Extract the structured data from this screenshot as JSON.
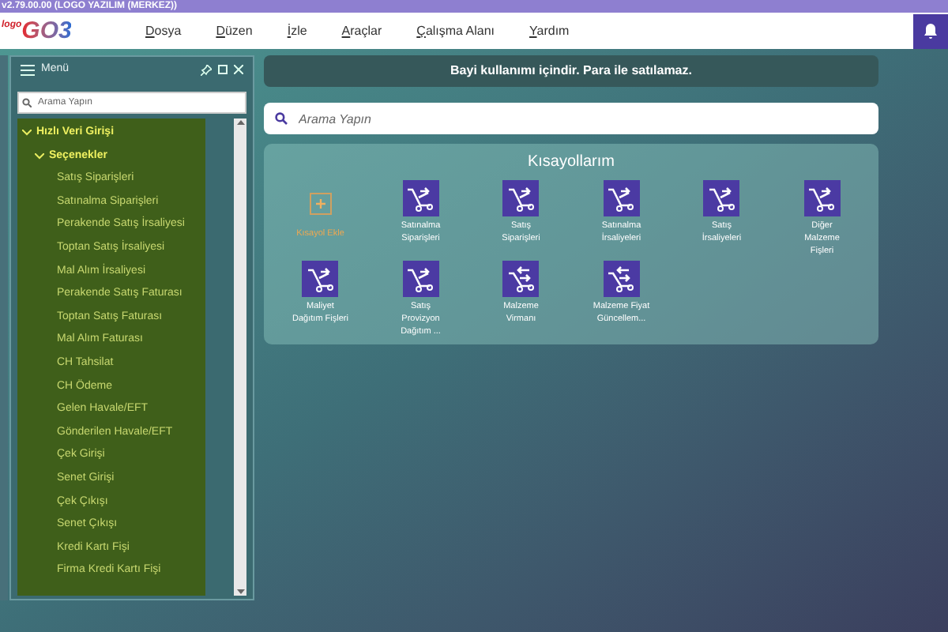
{
  "window": {
    "title": "v2.79.00.00 (LOGO YAZILIM (MERKEZ))"
  },
  "logo": {
    "prefix": "logo",
    "name": "GO3"
  },
  "menu_bar": [
    "Dosya",
    "Düzen",
    "İzle",
    "Araçlar",
    "Çalışma Alanı",
    "Yardım"
  ],
  "menu_panel": {
    "title": "Menü",
    "search": {
      "placeholder": "Arama Yapın"
    },
    "tree": [
      {
        "label": "Hızlı Veri Girişi",
        "expanded": true,
        "children": [
          {
            "label": "Seçenekler",
            "expanded": true,
            "children": [
              {
                "label": "Satış Siparişleri"
              },
              {
                "label": "Satınalma Siparişleri"
              },
              {
                "label": "Perakende Satış İrsaliyesi"
              },
              {
                "label": "Toptan Satış İrsaliyesi"
              },
              {
                "label": "Mal Alım İrsaliyesi"
              },
              {
                "label": "Perakende Satış Faturası"
              },
              {
                "label": "Toptan Satış Faturası"
              },
              {
                "label": "Mal Alım Faturası"
              },
              {
                "label": "CH Tahsilat"
              },
              {
                "label": "CH Ödeme"
              },
              {
                "label": "Gelen Havale/EFT"
              },
              {
                "label": "Gönderilen Havale/EFT"
              },
              {
                "label": "Çek Girişi"
              },
              {
                "label": "Senet Girişi"
              },
              {
                "label": "Çek Çıkışı"
              },
              {
                "label": "Senet Çıkışı"
              },
              {
                "label": "Kredi Kartı Fişi"
              },
              {
                "label": "Firma Kredi Kartı Fişi"
              }
            ]
          }
        ]
      }
    ]
  },
  "banner": "Bayi kullanımı içindir. Para ile satılamaz.",
  "search": {
    "placeholder": "Arama Yapın"
  },
  "shortcuts": {
    "title": "Kısayollarım",
    "items": [
      {
        "kind": "add",
        "label": "Kısayol Ekle"
      },
      {
        "kind": "cart",
        "label": "Satınalma Siparişleri"
      },
      {
        "kind": "cart",
        "label": "Satış Siparişleri"
      },
      {
        "kind": "cart",
        "label": "Satınalma İrsaliyeleri"
      },
      {
        "kind": "cart",
        "label": "Satış İrsaliyeleri"
      },
      {
        "kind": "cart",
        "label": "Diğer Malzeme Fişleri"
      },
      {
        "kind": "cart",
        "label": "Maliyet Dağıtım Fişleri"
      },
      {
        "kind": "cart",
        "label": "Satış Provizyon Dağıtım ..."
      },
      {
        "kind": "transfer",
        "label": "Malzeme Virmanı"
      },
      {
        "kind": "transfer",
        "label": "Malzeme Fiyat Güncellem..."
      }
    ]
  }
}
